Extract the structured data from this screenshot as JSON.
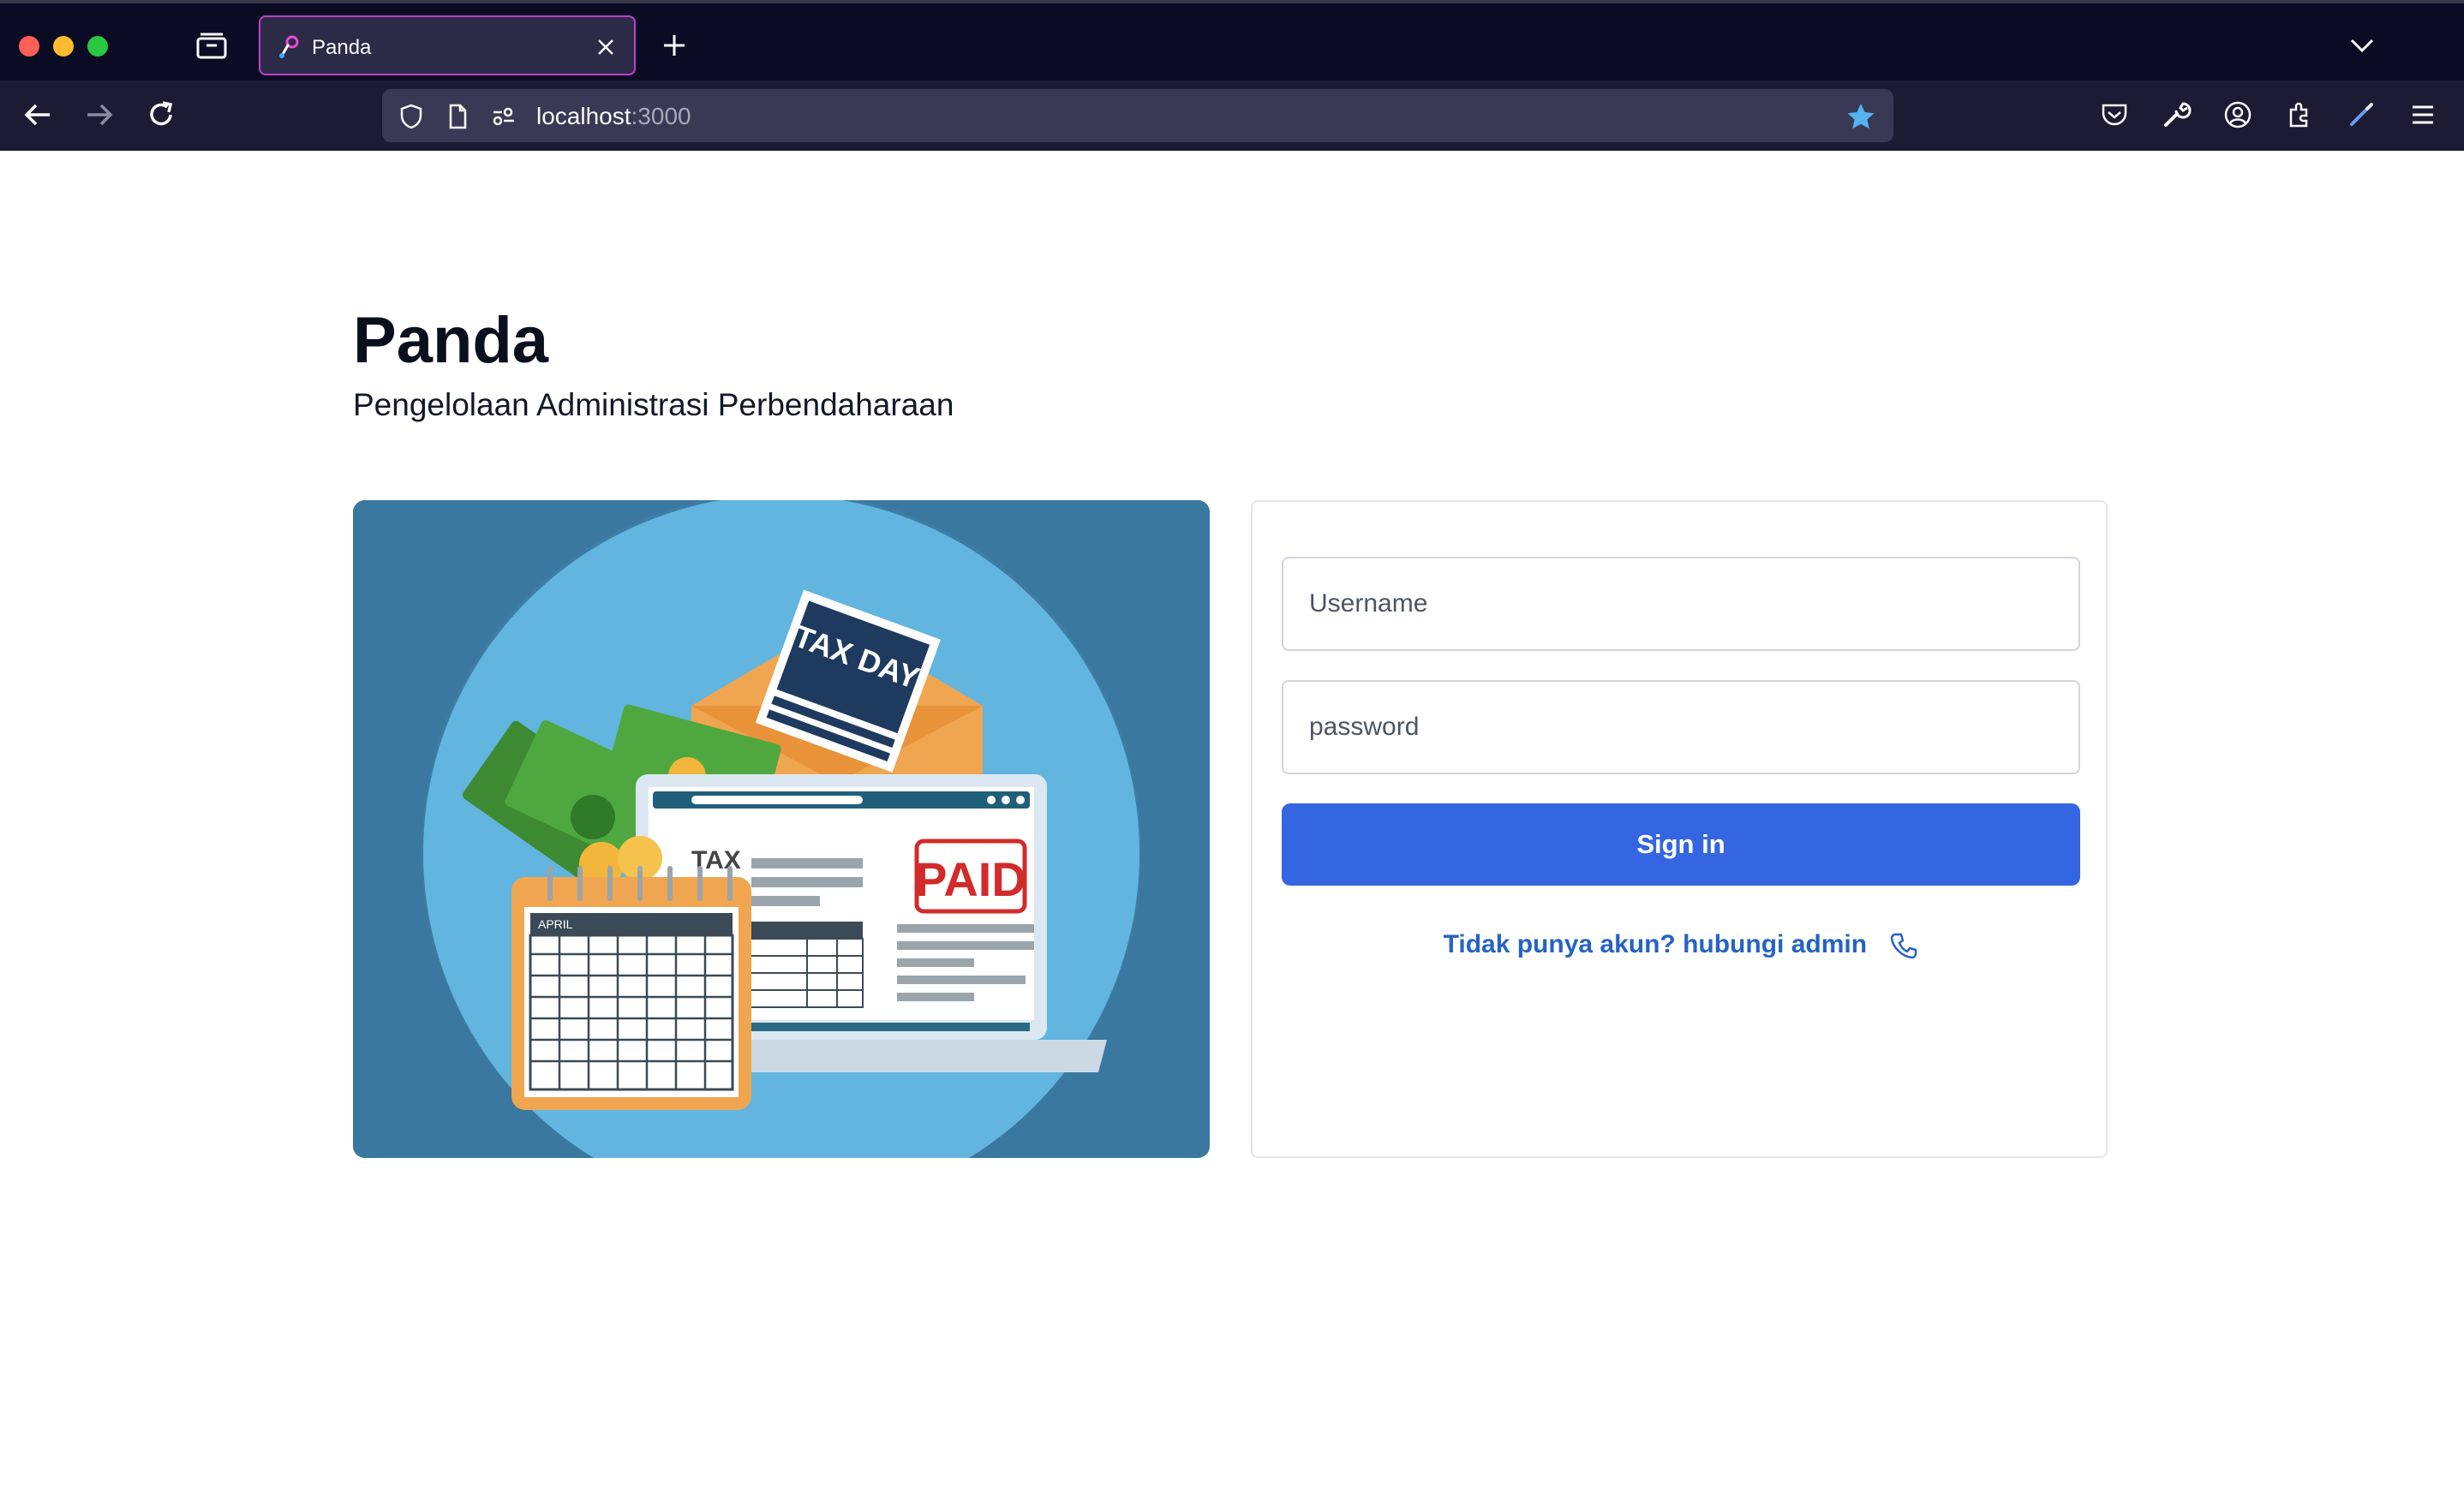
{
  "browser": {
    "tab_title": "Panda",
    "url_host": "localhost",
    "url_port": ":3000"
  },
  "page": {
    "title": "Panda",
    "subtitle": "Pengelolaan Administrasi Perbendaharaan"
  },
  "illustration": {
    "envelope_text": "TAX DAY",
    "stamp_text": "PAID",
    "calendar_month": "APRIL",
    "laptop_heading": "TAX"
  },
  "login": {
    "username_placeholder": "Username",
    "password_placeholder": "password",
    "signin_label": "Sign in",
    "contact_text": "Tidak punya akun? hubungi admin"
  },
  "colors": {
    "accent": "#3366e0",
    "link": "#2563c4",
    "hero_bg": "#3a78a0"
  }
}
